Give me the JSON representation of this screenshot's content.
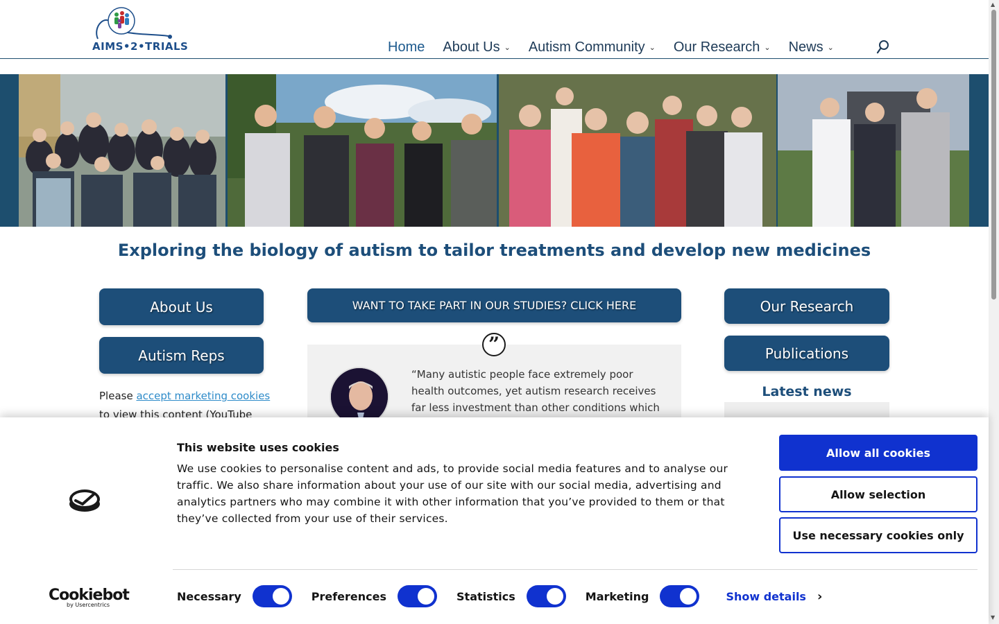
{
  "header": {
    "logo_text": "AIMS•2•TRIALS",
    "nav": [
      {
        "label": "Home",
        "active": true,
        "dropdown": false
      },
      {
        "label": "About Us",
        "active": false,
        "dropdown": true
      },
      {
        "label": "Autism Community",
        "active": false,
        "dropdown": true
      },
      {
        "label": "Our Research",
        "active": false,
        "dropdown": true
      },
      {
        "label": "News",
        "active": false,
        "dropdown": true
      }
    ],
    "search_icon": "search-icon"
  },
  "tagline": "Exploring the biology of autism to tailor treatments and develop new medicines",
  "left": {
    "about_button": "About Us",
    "reps_button": "Autism Reps",
    "text_before": "Please ",
    "link": "accept marketing cookies",
    "text_after": " to view this content (YouTube"
  },
  "center": {
    "cta_button": "WANT TO TAKE PART IN OUR STUDIES? CLICK HERE",
    "quote_icon": "”",
    "quote": "“Many autistic people face extremely poor health outcomes, yet autism research receives far less investment than other conditions which also limit"
  },
  "right": {
    "research_button": "Our Research",
    "publications_button": "Publications",
    "latest_news": "Latest news"
  },
  "cookie_banner": {
    "title": "This website uses cookies",
    "body": "We use cookies to personalise content and ads, to provide social media features and to analyse our traffic. We also share information about your use of our site with our social media, advertising and analytics partners who may combine it with other information that you’ve provided to them or that they’ve collected from your use of their services.",
    "allow_all": "Allow all cookies",
    "allow_selection": "Allow selection",
    "necessary_only": "Use necessary cookies only",
    "toggles": [
      {
        "label": "Necessary",
        "on": true
      },
      {
        "label": "Preferences",
        "on": true
      },
      {
        "label": "Statistics",
        "on": true
      },
      {
        "label": "Marketing",
        "on": true
      }
    ],
    "show_details": "Show details",
    "brand_name": "Cookiebot",
    "brand_sub": "by Usercentrics"
  },
  "colors": {
    "brand_blue": "#1d4e79",
    "cookie_blue": "#1032cf",
    "link_blue": "#2e8bc9"
  }
}
